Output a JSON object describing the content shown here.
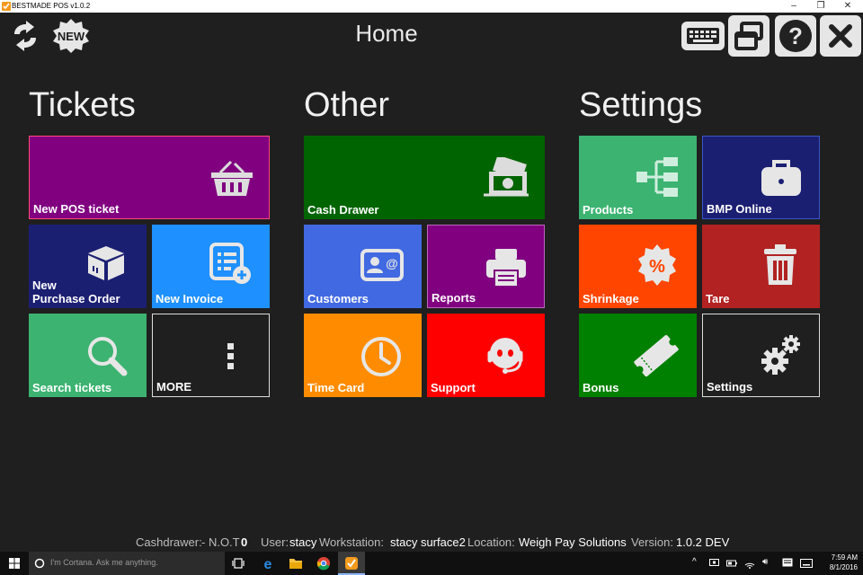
{
  "window": {
    "title": "BESTMADE POS v1.0.2",
    "controls": {
      "minimize": "–",
      "restore": "❐",
      "close": "✕"
    }
  },
  "header": {
    "title": "Home",
    "new_badge": "NEW",
    "icons": [
      "refresh-icon",
      "new-badge-icon",
      "keyboard-icon",
      "windows-icon",
      "help-icon",
      "close-icon"
    ]
  },
  "sections": {
    "tickets": "Tickets",
    "other": "Other",
    "settings": "Settings"
  },
  "tiles": {
    "new_pos_ticket": {
      "label": "New POS ticket",
      "color": "#800080",
      "icon": "basket-icon"
    },
    "new_purchase_order": {
      "label1": "New",
      "label2": "Purchase Order",
      "color": "#1b1f72",
      "icon": "box-icon"
    },
    "new_invoice": {
      "label": "New Invoice",
      "color": "#1e90ff",
      "icon": "invoice-add-icon"
    },
    "search_tickets": {
      "label": "Search tickets",
      "color": "#3cb371",
      "icon": "magnifier-icon"
    },
    "more": {
      "label": "MORE",
      "color": "#1f1f1f",
      "icon": "vertical-dots-icon"
    },
    "cash_drawer": {
      "label": "Cash Drawer",
      "color": "#006400",
      "icon": "cash-icon"
    },
    "customers": {
      "label": "Customers",
      "color": "#4169e1",
      "icon": "contact-card-icon"
    },
    "reports": {
      "label": "Reports",
      "color": "#800080",
      "icon": "printer-icon"
    },
    "time_card": {
      "label": "Time Card",
      "color": "#ff8c00",
      "icon": "clock-icon"
    },
    "support": {
      "label": "Support",
      "color": "#ff0000",
      "icon": "headset-icon"
    },
    "products": {
      "label": "Products",
      "color": "#3cb371",
      "icon": "hierarchy-icon"
    },
    "bmp_online": {
      "label": "BMP Online",
      "color": "#1b1f72",
      "icon": "briefcase-icon"
    },
    "shrinkage": {
      "label": "Shrinkage",
      "color": "#ff4500",
      "icon": "percent-badge-icon"
    },
    "tare": {
      "label": "Tare",
      "color": "#b22222",
      "icon": "trash-icon"
    },
    "bonus": {
      "label": "Bonus",
      "color": "#008000",
      "icon": "ticket-icon"
    },
    "settings": {
      "label": "Settings",
      "color": "#1f1f1f",
      "icon": "gears-icon"
    }
  },
  "status": {
    "cashdrawer_label": "Cashdrawer:",
    "cashdrawer_value": "- N.O.T",
    "cashdrawer_count": "0",
    "user_label": "User:",
    "user_value": "stacy",
    "workstation_label": "Workstation:",
    "workstation_value": "stacy surface2",
    "location_label": "Location:",
    "location_value": "Weigh Pay Solutions",
    "version_label": "Version:",
    "version_value": "1.0.2 DEV"
  },
  "taskbar": {
    "cortana_placeholder": "I'm Cortana. Ask me anything.",
    "time": "7:59 AM",
    "date": "8/1/2016"
  }
}
